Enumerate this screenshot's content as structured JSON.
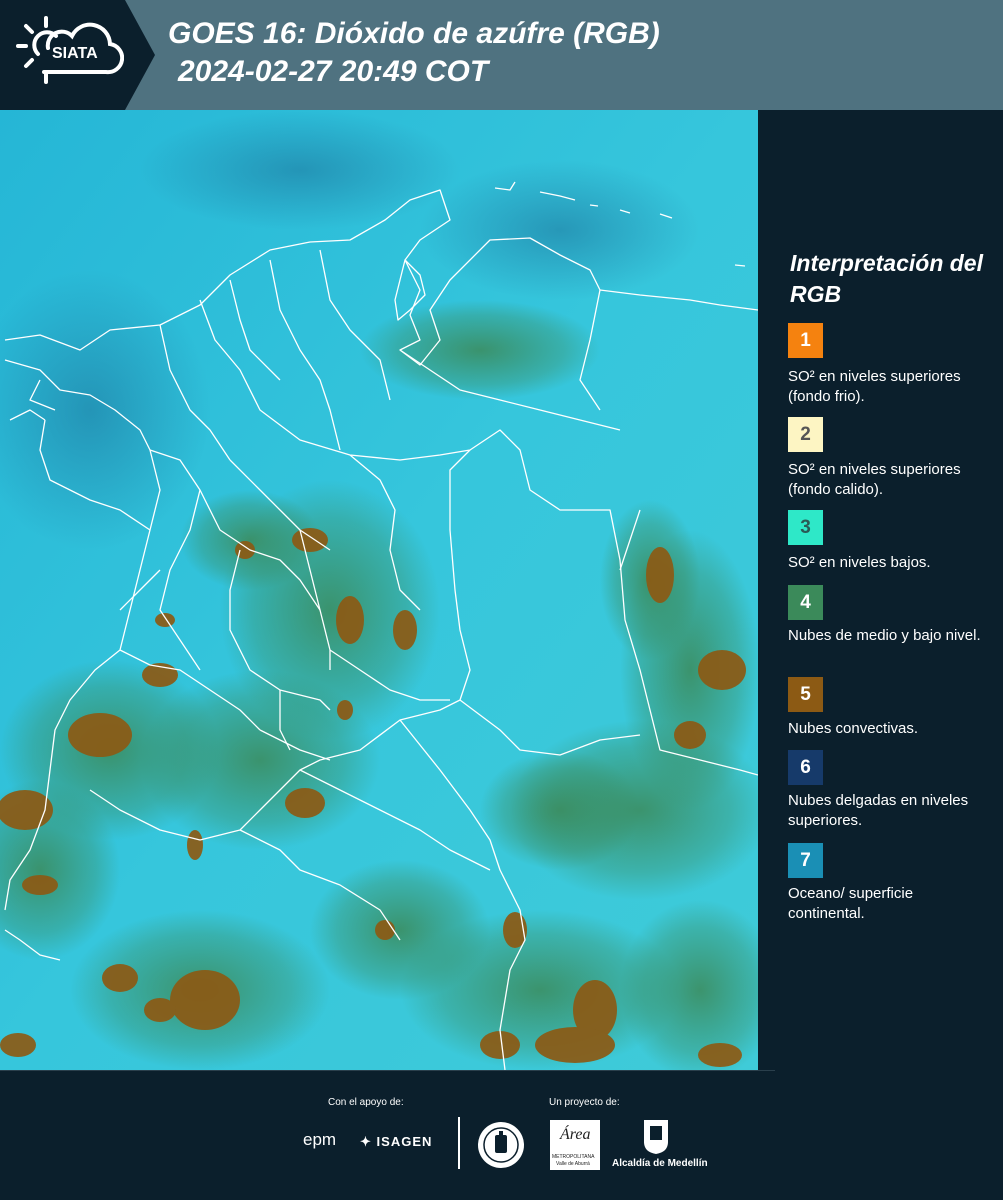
{
  "header": {
    "logo_text": "SIATA",
    "title": "GOES 16: Dióxido de azúfre (RGB)",
    "datetime": "2024-02-27 20:49 COT"
  },
  "legend": {
    "title": "Interpretación del RGB",
    "items": [
      {
        "number": "1",
        "color": "#f5820f",
        "number_color": "#ffffff",
        "label": "SO² en niveles superiores (fondo frio)."
      },
      {
        "number": "2",
        "color": "#fdf5c3",
        "number_color": "#555555",
        "label": "SO² en niveles superiores (fondo calido)."
      },
      {
        "number": "3",
        "color": "#2ee8c8",
        "number_color": "#2a5a55",
        "label": "SO² en niveles bajos."
      },
      {
        "number": "4",
        "color": "#3b8a5a",
        "number_color": "#ffffff",
        "label": "Nubes de medio y bajo nivel."
      },
      {
        "number": "5",
        "color": "#8c5a14",
        "number_color": "#ffffff",
        "label": "Nubes convectivas."
      },
      {
        "number": "6",
        "color": "#163a6a",
        "number_color": "#ffffff",
        "label": "Nubes delgadas en niveles superiores."
      },
      {
        "number": "7",
        "color": "#1a8fb5",
        "number_color": "#ffffff",
        "label": "Oceano/ superficie continental."
      }
    ]
  },
  "map": {
    "background_color": "#2bbfd8",
    "cloud_color": "#3b8a5a",
    "convective_color": "#8c5a14",
    "border_color": "#ffffff"
  },
  "footer": {
    "support_label": "Con el apoyo de:",
    "project_label": "Un proyecto de:",
    "sponsors": [
      "epm",
      "ISAGEN"
    ],
    "area_logo_title": "Área",
    "area_logo_line1": "METROPOLITANA",
    "area_logo_line2": "Valle de Aburrá",
    "alcaldia": "Alcaldía de Medellín"
  }
}
